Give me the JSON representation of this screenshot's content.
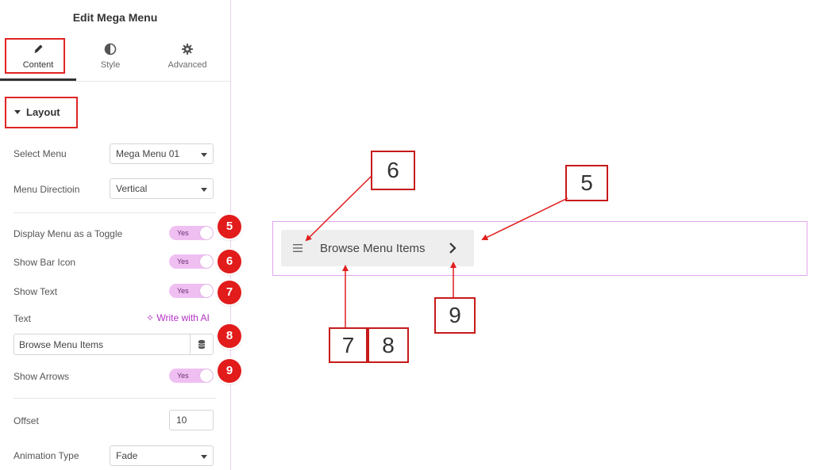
{
  "panel": {
    "title": "Edit Mega Menu",
    "tabs": [
      {
        "label": "Content",
        "icon": "pencil-icon"
      },
      {
        "label": "Style",
        "icon": "half-circle-icon"
      },
      {
        "label": "Advanced",
        "icon": "gear-icon"
      }
    ],
    "section_title": "Layout",
    "controls": {
      "select_menu": {
        "label": "Select Menu",
        "value": "Mega Menu 01"
      },
      "menu_direction": {
        "label": "Menu Directioin",
        "value": "Vertical"
      },
      "display_toggle": {
        "label": "Display Menu as a Toggle",
        "value": "Yes"
      },
      "show_bar_icon": {
        "label": "Show Bar Icon",
        "value": "Yes"
      },
      "show_text": {
        "label": "Show Text",
        "value": "Yes"
      },
      "text": {
        "label": "Text",
        "value": "Browse Menu Items",
        "ai_link": "Write with AI"
      },
      "show_arrows": {
        "label": "Show Arrows",
        "value": "Yes"
      },
      "offset": {
        "label": "Offset",
        "value": "10"
      },
      "animation_type": {
        "label": "Animation Type",
        "value": "Fade"
      }
    }
  },
  "badges": [
    "5",
    "6",
    "7",
    "8",
    "9"
  ],
  "canvas": {
    "menu_text": "Browse Menu Items"
  },
  "callouts": {
    "c6": "6",
    "c5": "5",
    "c7": "7",
    "c8": "8",
    "c9": "9"
  },
  "colors": {
    "accent_red": "#e02424",
    "toggle_pink": "#f0bff2",
    "ai_purple": "#b433c4"
  }
}
